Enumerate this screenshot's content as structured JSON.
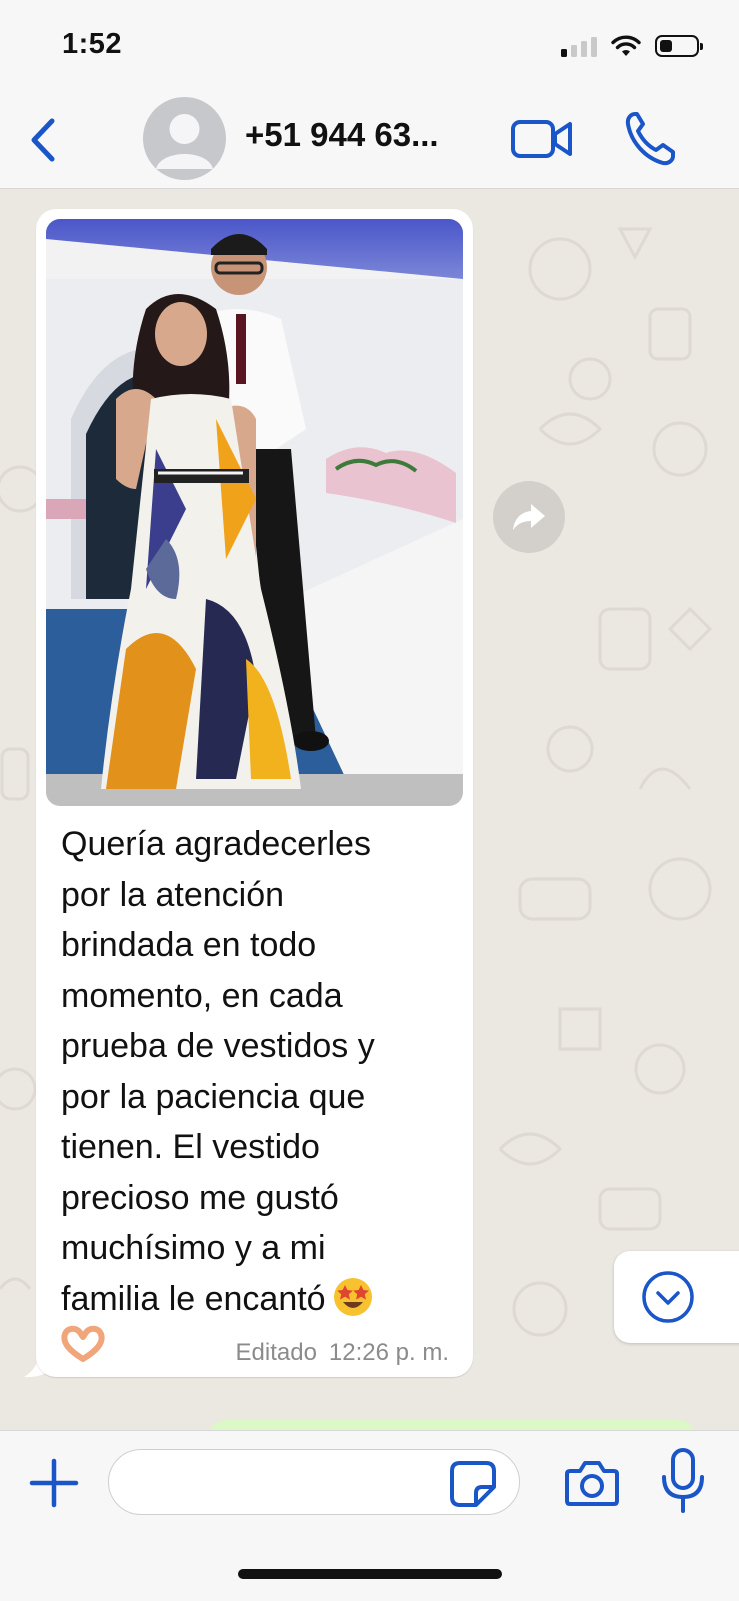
{
  "status_bar": {
    "time": "1:52",
    "signal_bars_active": 1,
    "battery_level": 0.3
  },
  "header": {
    "contact_name": "+51 944 63...",
    "accent_color": "#1a56c7",
    "icons": [
      "chevron-left-icon",
      "avatar-placeholder-icon",
      "video-camera-icon",
      "phone-icon"
    ]
  },
  "message": {
    "text": "Quería agradecerles\npor la atención\nbrindada en todo\nmomento, en cada\nprueba de vestidos y\npor la paciencia que\ntienen. El vestido\nprecioso me gustó\nmuchísimo y a mi\nfamilia le encantó",
    "emojis": [
      "star-struck-emoji",
      "heart-hands-emoji"
    ],
    "edited_label": "Editado",
    "timestamp": "12:26 p. m."
  },
  "chat_controls": {
    "icons": [
      "forward-icon",
      "chevron-down-circle-icon"
    ]
  },
  "input_bar": {
    "value": "",
    "placeholder": "",
    "icons": [
      "plus-icon",
      "sticker-icon",
      "camera-icon",
      "microphone-icon"
    ]
  }
}
